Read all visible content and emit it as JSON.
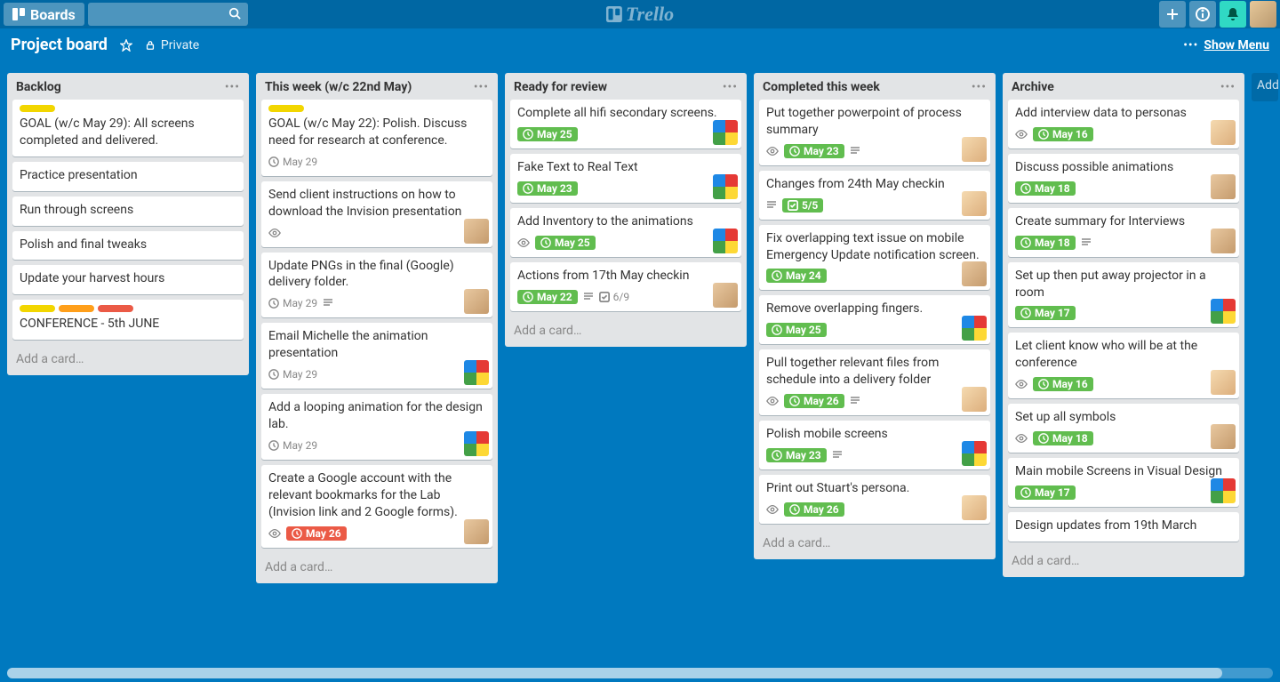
{
  "header": {
    "boards_label": "Boards",
    "logo_text": "Trello"
  },
  "board": {
    "title": "Project board",
    "visibility": "Private",
    "show_menu": "Show Menu"
  },
  "lists": [
    {
      "title": "Backlog",
      "add_card": "Add a card…",
      "cards": [
        {
          "labels": [
            "yellow"
          ],
          "title": "GOAL (w/c May 29): All screens completed and delivered."
        },
        {
          "title": "Practice presentation"
        },
        {
          "title": "Run through screens"
        },
        {
          "title": "Polish and final tweaks"
        },
        {
          "title": "Update your harvest hours"
        },
        {
          "labels": [
            "yellow",
            "orange",
            "red"
          ],
          "title": "CONFERENCE - 5th JUNE"
        }
      ]
    },
    {
      "title": "This week (w/c 22nd May)",
      "add_card": "Add a card…",
      "cards": [
        {
          "labels": [
            "yellow"
          ],
          "title": "GOAL (w/c May 22): Polish. Discuss need for research at conference.",
          "due": "May 29",
          "due_color": "plain"
        },
        {
          "title": "Send client instructions on how to download the Invision presentation",
          "watch": true,
          "avatar": "person"
        },
        {
          "title": "Update PNGs in the final (Google) delivery folder.",
          "due": "May 29",
          "due_color": "plain",
          "desc": true,
          "avatar": "person"
        },
        {
          "title": "Email Michelle the animation presentation",
          "due": "May 29",
          "due_color": "plain",
          "avatar": "colors"
        },
        {
          "title": "Add a looping animation for the design lab.",
          "due": "May 29",
          "due_color": "plain",
          "avatar": "colors"
        },
        {
          "title": "Create a Google account with the relevant bookmarks for the Lab (Invision link and 2 Google forms).",
          "watch": true,
          "due": "May 26",
          "due_color": "red",
          "avatar": "person"
        }
      ]
    },
    {
      "title": "Ready for review",
      "add_card": "Add a card…",
      "cards": [
        {
          "title": "Complete all hifi secondary screens.",
          "due": "May 25",
          "due_color": "green",
          "avatar": "colors"
        },
        {
          "title": "Fake Text to Real Text",
          "due": "May 23",
          "due_color": "green",
          "avatar": "colors"
        },
        {
          "title": "Add Inventory to the animations",
          "watch": true,
          "due": "May 25",
          "due_color": "green",
          "avatar": "colors"
        },
        {
          "title": "Actions from 17th May checkin",
          "due": "May 22",
          "due_color": "green",
          "desc": true,
          "checklist": "6/9",
          "avatar": "person"
        }
      ]
    },
    {
      "title": "Completed this week",
      "add_card": "Add a card…",
      "cards": [
        {
          "title": "Put together powerpoint of process summary",
          "watch": true,
          "due": "May 23",
          "due_color": "green",
          "desc": true,
          "avatar": "person2"
        },
        {
          "title": "Changes from 24th May checkin",
          "desc": true,
          "check_done": "5/5",
          "avatar": "person2"
        },
        {
          "title": "Fix overlapping text issue on mobile Emergency Update notification screen.",
          "due": "May 24",
          "due_color": "green",
          "avatar": "person"
        },
        {
          "title": "Remove overlapping fingers.",
          "due": "May 25",
          "due_color": "green",
          "avatar": "colors"
        },
        {
          "title": "Pull together relevant files from schedule into a delivery folder",
          "watch": true,
          "due": "May 26",
          "due_color": "green",
          "desc": true,
          "avatar": "person2"
        },
        {
          "title": "Polish mobile screens",
          "due": "May 23",
          "due_color": "green",
          "desc": true,
          "avatar": "colors"
        },
        {
          "title": "Print out Stuart's persona.",
          "watch": true,
          "due": "May 26",
          "due_color": "green",
          "avatar": "person2"
        }
      ]
    },
    {
      "title": "Archive",
      "add_card": "Add a card…",
      "cards": [
        {
          "title": "Add interview data to personas",
          "watch": true,
          "due": "May 16",
          "due_color": "green",
          "avatar": "person2"
        },
        {
          "title": "Discuss possible animations",
          "due": "May 18",
          "due_color": "green",
          "avatar": "person"
        },
        {
          "title": "Create summary for Interviews",
          "due": "May 18",
          "due_color": "green",
          "desc": true,
          "avatar": "person"
        },
        {
          "title": "Set up then put away projector in a room",
          "due": "May 17",
          "due_color": "green",
          "avatar": "colors"
        },
        {
          "title": "Let client know who will be at the conference",
          "watch": true,
          "due": "May 16",
          "due_color": "green",
          "avatar": "person2"
        },
        {
          "title": "Set up all symbols",
          "watch": true,
          "due": "May 18",
          "due_color": "green",
          "avatar": "person"
        },
        {
          "title": "Main mobile Screens in Visual Design",
          "due": "May 17",
          "due_color": "green",
          "avatar": "colors"
        },
        {
          "title": "Design updates from 19th March"
        }
      ]
    }
  ],
  "extra_list_label": "Add"
}
